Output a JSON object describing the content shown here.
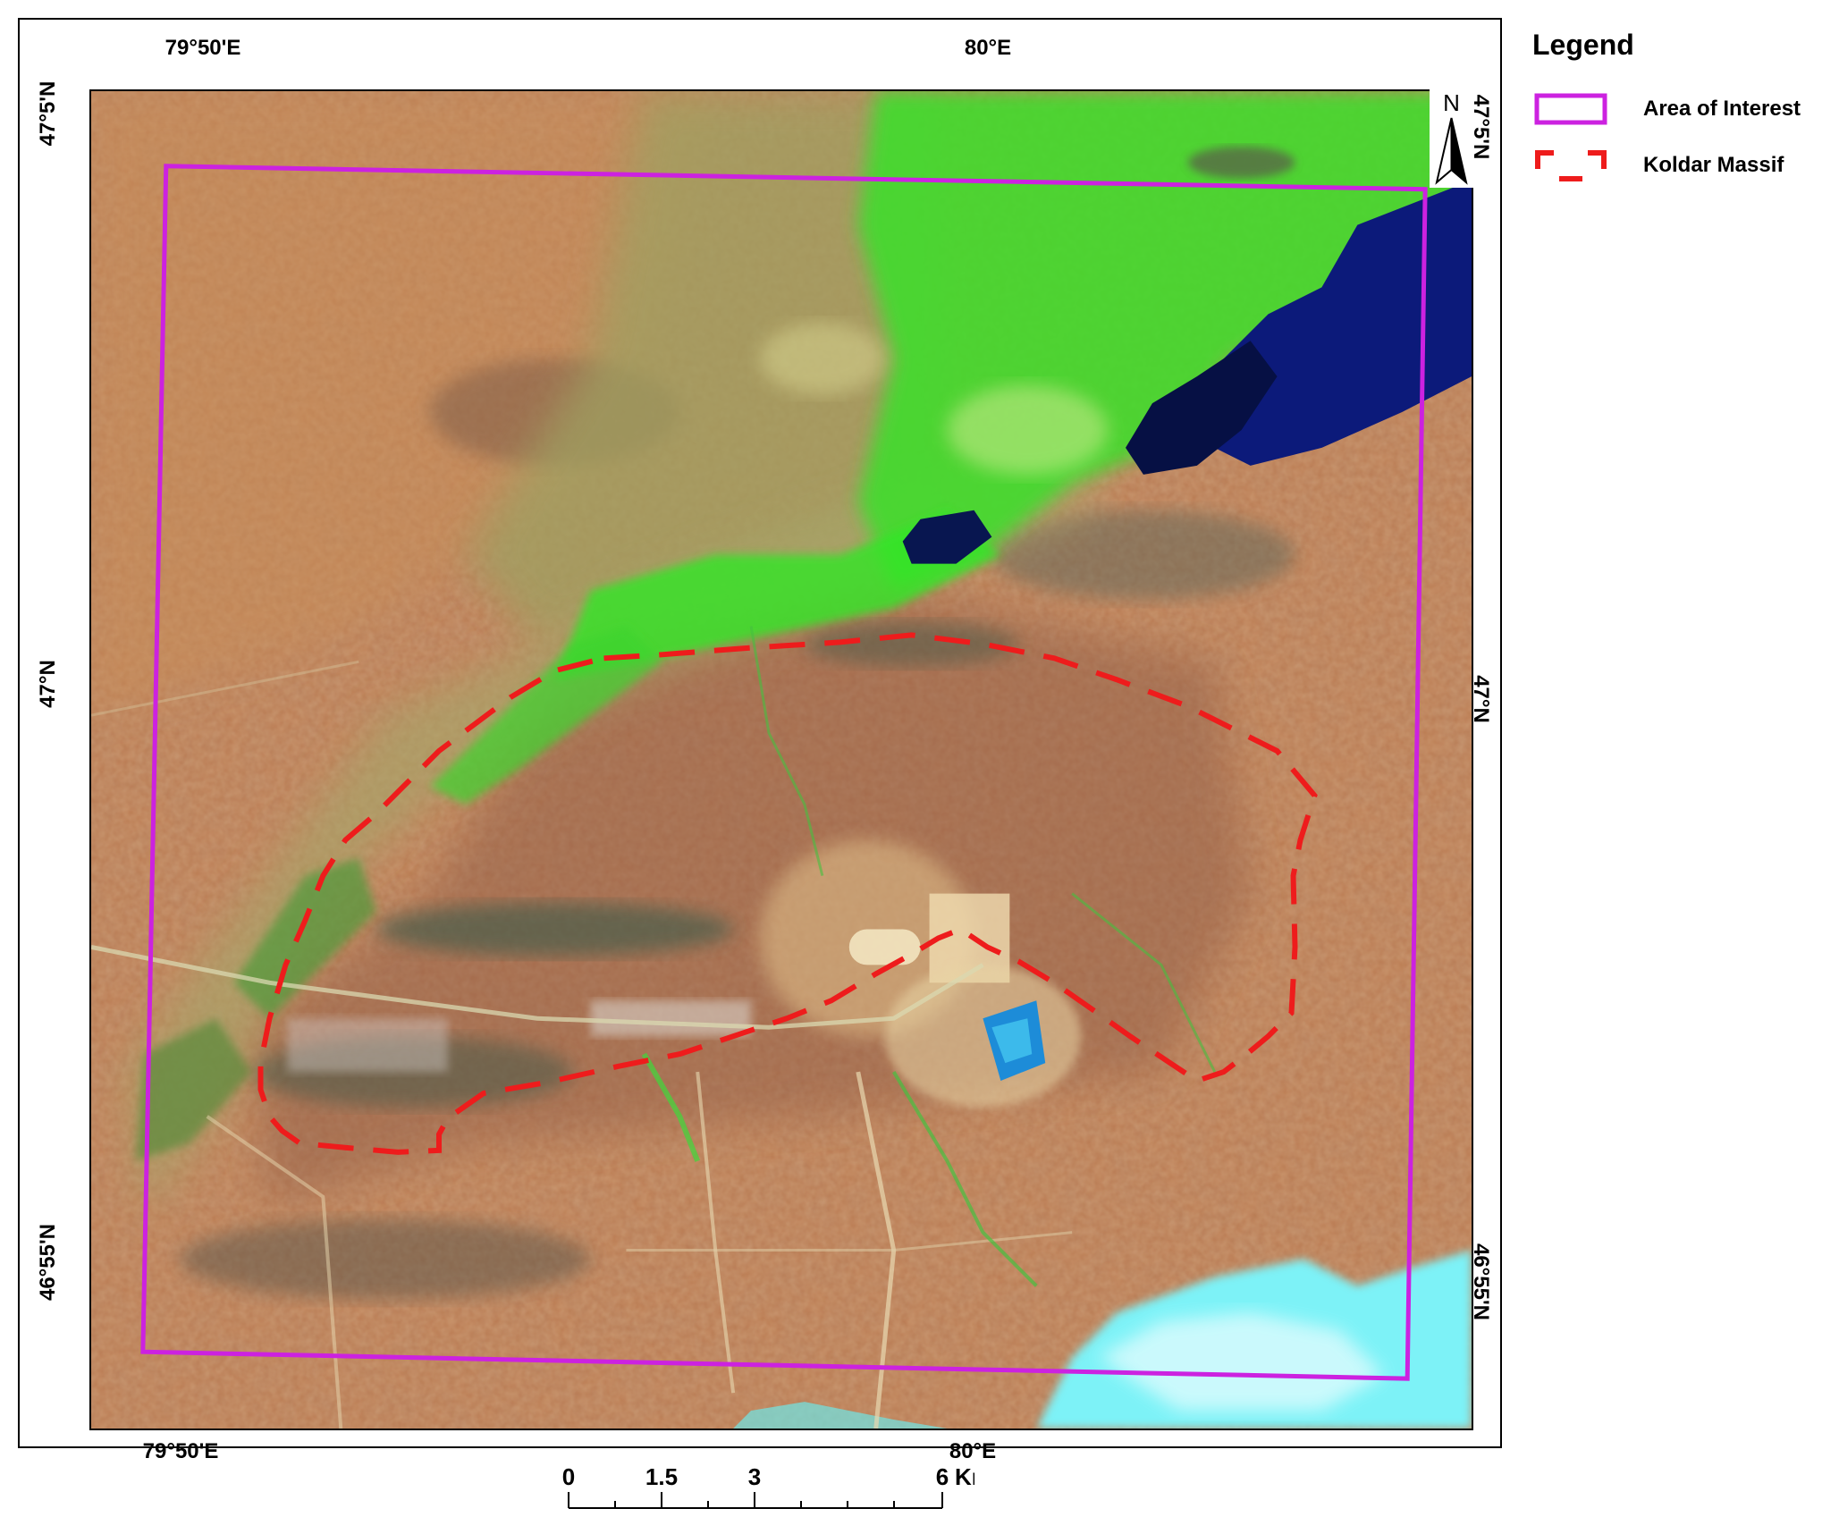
{
  "map": {
    "coords": {
      "top": [
        "79°50'E",
        "80°E"
      ],
      "bottom": [
        "79°50'E",
        "80°E"
      ],
      "left": [
        "47°5'N",
        "47°N",
        "46°55'N"
      ],
      "right": [
        "47°5'N",
        "47°N",
        "46°55'N"
      ]
    },
    "north_label": "N",
    "scale": {
      "labels": [
        "0",
        "1.5",
        "3",
        "6"
      ],
      "unit": "Km"
    },
    "colors": {
      "area_of_interest": "#cc22e0",
      "koldar_massif": "#ee1c1c",
      "terrain": "#b9764e",
      "vegetation": "#37e52a",
      "water": "#0c1a7a",
      "salt_flat": "#7df2f7"
    }
  },
  "legend": {
    "title": "Legend",
    "items": [
      {
        "label": "Area of Interest",
        "symbol": "solid-rectangle"
      },
      {
        "label": "Koldar Massif",
        "symbol": "dashed-outline"
      }
    ]
  }
}
